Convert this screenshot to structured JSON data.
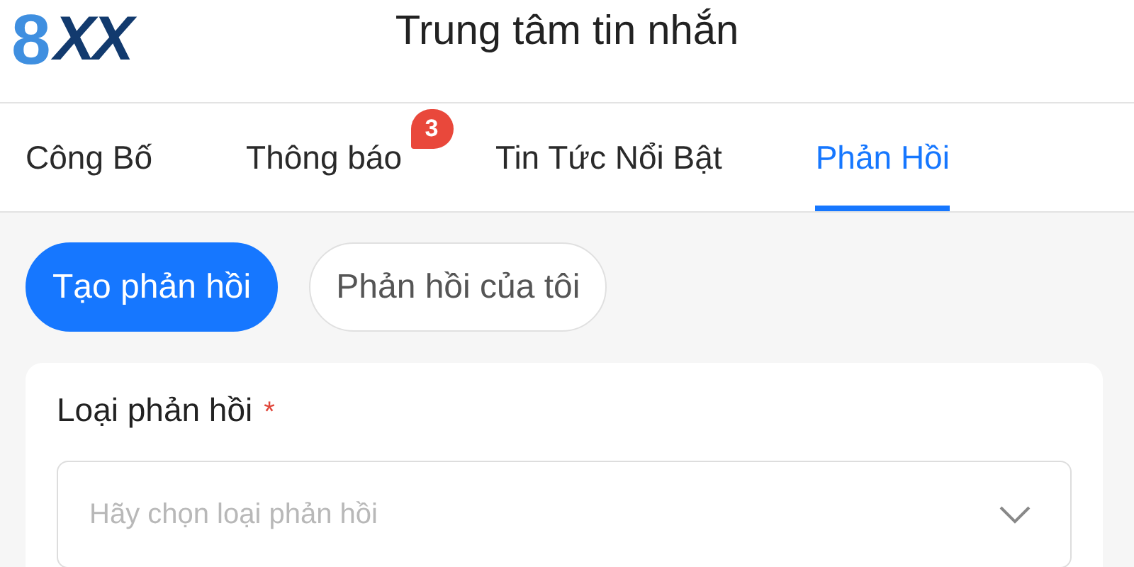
{
  "header": {
    "logo": {
      "lead": "8",
      "rest": "XX"
    },
    "title": "Trung tâm tin nhắn"
  },
  "tabs": [
    {
      "label": "Công Bố",
      "selected": false
    },
    {
      "label": "Thông báo",
      "selected": false,
      "badge": "3"
    },
    {
      "label": "Tin Tức Nổi Bật",
      "selected": false
    },
    {
      "label": "Phản Hồi",
      "selected": true
    }
  ],
  "segments": [
    {
      "label": "Tạo phản hồi",
      "selected": true
    },
    {
      "label": "Phản hồi của tôi",
      "selected": false
    }
  ],
  "form": {
    "field_label": "Loại phản hồi",
    "required": true,
    "required_mark": "*",
    "select": {
      "placeholder": "Hãy chọn loại phản hồi"
    }
  }
}
